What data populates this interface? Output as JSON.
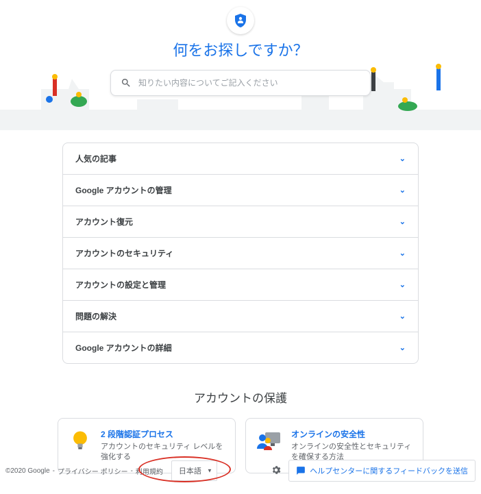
{
  "hero": {
    "title": "何をお探しですか？",
    "search_placeholder": "知りたい内容についてご記入ください"
  },
  "accordion": {
    "items": [
      {
        "label": "人気の記事"
      },
      {
        "label": "Google アカウントの管理"
      },
      {
        "label": "アカウント復元"
      },
      {
        "label": "アカウントのセキュリティ"
      },
      {
        "label": "アカウントの設定と管理"
      },
      {
        "label": "問題の解決"
      },
      {
        "label": "Google アカウントの詳細"
      }
    ]
  },
  "protect": {
    "heading": "アカウントの保護",
    "cards": [
      {
        "title": "2 段階認証プロセス",
        "desc": "アカウントのセキュリティ レベルを強化する"
      },
      {
        "title": "オンラインの安全性",
        "desc": "オンラインの安全性とセキュリティを確保する方法"
      }
    ]
  },
  "footer": {
    "copyright": "©2020 Google",
    "privacy": "プライバシー ポリシー",
    "terms": "利用規約",
    "language": "日本語",
    "feedback": "ヘルプセンターに関するフィードバックを送信"
  }
}
